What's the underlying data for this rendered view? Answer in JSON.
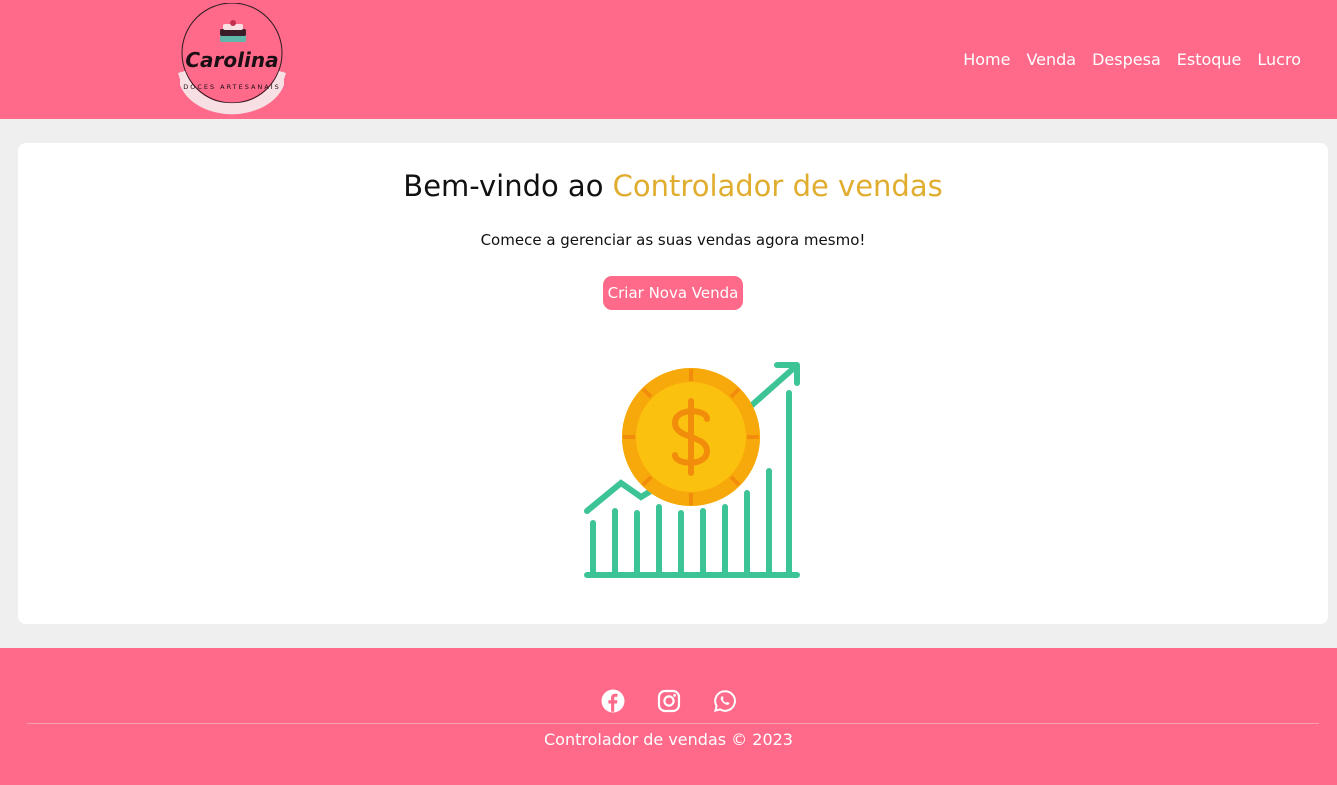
{
  "brand": {
    "name": "Carolina",
    "tagline": "DOCES ARTESANAIS"
  },
  "nav": {
    "items": [
      {
        "label": "Home"
      },
      {
        "label": "Venda"
      },
      {
        "label": "Despesa"
      },
      {
        "label": "Estoque"
      },
      {
        "label": "Lucro"
      }
    ]
  },
  "hero": {
    "title_prefix": "Bem-vindo ao ",
    "title_accent": "Controlador de vendas",
    "subtitle": "Comece a gerenciar as suas vendas agora mesmo!",
    "cta_label": "Criar Nova Venda",
    "illustration_icon": "dollar-coin-growth-chart-icon"
  },
  "footer": {
    "social": [
      {
        "icon": "facebook-icon"
      },
      {
        "icon": "instagram-icon"
      },
      {
        "icon": "whatsapp-icon"
      }
    ],
    "copyright": "Controlador de vendas © 2023"
  },
  "colors": {
    "brand_pink": "#ff6a8b",
    "accent_gold": "#e0ad2f",
    "chart_green": "#3cc497",
    "coin_yellow": "#fbc10f",
    "coin_orange": "#f7a80a",
    "background": "#efefef"
  }
}
